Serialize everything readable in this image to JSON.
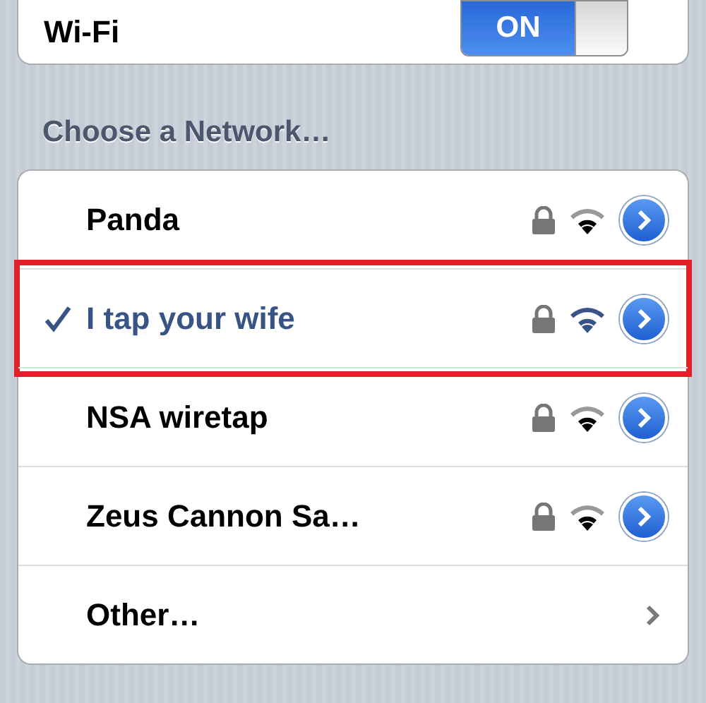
{
  "wifi": {
    "label": "Wi-Fi",
    "on": true,
    "on_text": "ON"
  },
  "section_title": "Choose a Network…",
  "networks": [
    {
      "kind": "network",
      "name": "Panda",
      "selected": false,
      "highlighted": false
    },
    {
      "kind": "network",
      "name": "I tap your wife",
      "selected": true,
      "highlighted": true
    },
    {
      "kind": "network",
      "name": "NSA wiretap",
      "selected": false,
      "highlighted": false
    },
    {
      "kind": "network",
      "name": "Zeus Cannon Sa…",
      "selected": false,
      "highlighted": false
    },
    {
      "kind": "other",
      "name": "Other…",
      "selected": false,
      "highlighted": false
    }
  ]
}
